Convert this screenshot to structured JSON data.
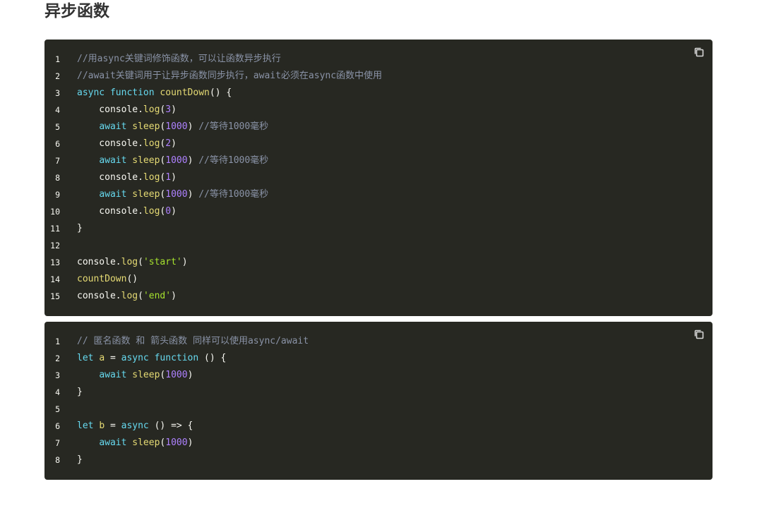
{
  "page": {
    "heading": "异步函数"
  },
  "colors": {
    "code_background": "#272822",
    "comment": "#8a93a7",
    "keyword": "#66d9ef",
    "function": "#e6db74",
    "number": "#ae81ff",
    "string": "#a6e22e",
    "plain": "#f8f8f2"
  },
  "icons": {
    "copy": "copy-icon"
  },
  "code_blocks": [
    {
      "lines": [
        {
          "n": "1",
          "tokens": [
            {
              "t": "comment",
              "v": "//用async关键词修饰函数，可以让函数异步执行"
            }
          ]
        },
        {
          "n": "2",
          "tokens": [
            {
              "t": "comment",
              "v": "//await关键词用于让异步函数同步执行，await必须在async函数中使用"
            }
          ]
        },
        {
          "n": "3",
          "tokens": [
            {
              "t": "kw",
              "v": "async"
            },
            {
              "t": "plain",
              "v": " "
            },
            {
              "t": "kw",
              "v": "function"
            },
            {
              "t": "plain",
              "v": " "
            },
            {
              "t": "fn",
              "v": "countDown"
            },
            {
              "t": "plain",
              "v": "() {"
            }
          ]
        },
        {
          "n": "4",
          "tokens": [
            {
              "t": "plain",
              "v": "    console."
            },
            {
              "t": "fn",
              "v": "log"
            },
            {
              "t": "plain",
              "v": "("
            },
            {
              "t": "num",
              "v": "3"
            },
            {
              "t": "plain",
              "v": ")"
            }
          ]
        },
        {
          "n": "5",
          "tokens": [
            {
              "t": "plain",
              "v": "    "
            },
            {
              "t": "kw",
              "v": "await"
            },
            {
              "t": "plain",
              "v": " "
            },
            {
              "t": "fn",
              "v": "sleep"
            },
            {
              "t": "plain",
              "v": "("
            },
            {
              "t": "num",
              "v": "1000"
            },
            {
              "t": "plain",
              "v": ") "
            },
            {
              "t": "comment",
              "v": "//等待1000毫秒"
            }
          ]
        },
        {
          "n": "6",
          "tokens": [
            {
              "t": "plain",
              "v": "    console."
            },
            {
              "t": "fn",
              "v": "log"
            },
            {
              "t": "plain",
              "v": "("
            },
            {
              "t": "num",
              "v": "2"
            },
            {
              "t": "plain",
              "v": ")"
            }
          ]
        },
        {
          "n": "7",
          "tokens": [
            {
              "t": "plain",
              "v": "    "
            },
            {
              "t": "kw",
              "v": "await"
            },
            {
              "t": "plain",
              "v": " "
            },
            {
              "t": "fn",
              "v": "sleep"
            },
            {
              "t": "plain",
              "v": "("
            },
            {
              "t": "num",
              "v": "1000"
            },
            {
              "t": "plain",
              "v": ") "
            },
            {
              "t": "comment",
              "v": "//等待1000毫秒"
            }
          ]
        },
        {
          "n": "8",
          "tokens": [
            {
              "t": "plain",
              "v": "    console."
            },
            {
              "t": "fn",
              "v": "log"
            },
            {
              "t": "plain",
              "v": "("
            },
            {
              "t": "num",
              "v": "1"
            },
            {
              "t": "plain",
              "v": ")"
            }
          ]
        },
        {
          "n": "9",
          "tokens": [
            {
              "t": "plain",
              "v": "    "
            },
            {
              "t": "kw",
              "v": "await"
            },
            {
              "t": "plain",
              "v": " "
            },
            {
              "t": "fn",
              "v": "sleep"
            },
            {
              "t": "plain",
              "v": "("
            },
            {
              "t": "num",
              "v": "1000"
            },
            {
              "t": "plain",
              "v": ") "
            },
            {
              "t": "comment",
              "v": "//等待1000毫秒"
            }
          ]
        },
        {
          "n": "10",
          "tokens": [
            {
              "t": "plain",
              "v": "    console."
            },
            {
              "t": "fn",
              "v": "log"
            },
            {
              "t": "plain",
              "v": "("
            },
            {
              "t": "num",
              "v": "0"
            },
            {
              "t": "plain",
              "v": ")"
            }
          ]
        },
        {
          "n": "11",
          "tokens": [
            {
              "t": "plain",
              "v": "}"
            }
          ]
        },
        {
          "n": "12",
          "tokens": []
        },
        {
          "n": "13",
          "tokens": [
            {
              "t": "plain",
              "v": "console."
            },
            {
              "t": "fn",
              "v": "log"
            },
            {
              "t": "plain",
              "v": "("
            },
            {
              "t": "str",
              "v": "'start'"
            },
            {
              "t": "plain",
              "v": ")"
            }
          ]
        },
        {
          "n": "14",
          "tokens": [
            {
              "t": "fn",
              "v": "countDown"
            },
            {
              "t": "plain",
              "v": "()"
            }
          ]
        },
        {
          "n": "15",
          "tokens": [
            {
              "t": "plain",
              "v": "console."
            },
            {
              "t": "fn",
              "v": "log"
            },
            {
              "t": "plain",
              "v": "("
            },
            {
              "t": "str",
              "v": "'end'"
            },
            {
              "t": "plain",
              "v": ")"
            }
          ]
        }
      ]
    },
    {
      "lines": [
        {
          "n": "1",
          "tokens": [
            {
              "t": "comment",
              "v": "// 匿名函数 和 箭头函数 同样可以使用async/await"
            }
          ]
        },
        {
          "n": "2",
          "tokens": [
            {
              "t": "kw",
              "v": "let"
            },
            {
              "t": "plain",
              "v": " "
            },
            {
              "t": "fn",
              "v": "a"
            },
            {
              "t": "plain",
              "v": " = "
            },
            {
              "t": "kw",
              "v": "async"
            },
            {
              "t": "plain",
              "v": " "
            },
            {
              "t": "kw",
              "v": "function"
            },
            {
              "t": "plain",
              "v": " () {"
            }
          ]
        },
        {
          "n": "3",
          "tokens": [
            {
              "t": "plain",
              "v": "    "
            },
            {
              "t": "kw",
              "v": "await"
            },
            {
              "t": "plain",
              "v": " "
            },
            {
              "t": "fn",
              "v": "sleep"
            },
            {
              "t": "plain",
              "v": "("
            },
            {
              "t": "num",
              "v": "1000"
            },
            {
              "t": "plain",
              "v": ")"
            }
          ]
        },
        {
          "n": "4",
          "tokens": [
            {
              "t": "plain",
              "v": "}"
            }
          ]
        },
        {
          "n": "5",
          "tokens": []
        },
        {
          "n": "6",
          "tokens": [
            {
              "t": "kw",
              "v": "let"
            },
            {
              "t": "plain",
              "v": " "
            },
            {
              "t": "fn",
              "v": "b"
            },
            {
              "t": "plain",
              "v": " = "
            },
            {
              "t": "kw",
              "v": "async"
            },
            {
              "t": "plain",
              "v": " () => {"
            }
          ]
        },
        {
          "n": "7",
          "tokens": [
            {
              "t": "plain",
              "v": "    "
            },
            {
              "t": "kw",
              "v": "await"
            },
            {
              "t": "plain",
              "v": " "
            },
            {
              "t": "fn",
              "v": "sleep"
            },
            {
              "t": "plain",
              "v": "("
            },
            {
              "t": "num",
              "v": "1000"
            },
            {
              "t": "plain",
              "v": ")"
            }
          ]
        },
        {
          "n": "8",
          "tokens": [
            {
              "t": "plain",
              "v": "}"
            }
          ]
        }
      ]
    }
  ]
}
